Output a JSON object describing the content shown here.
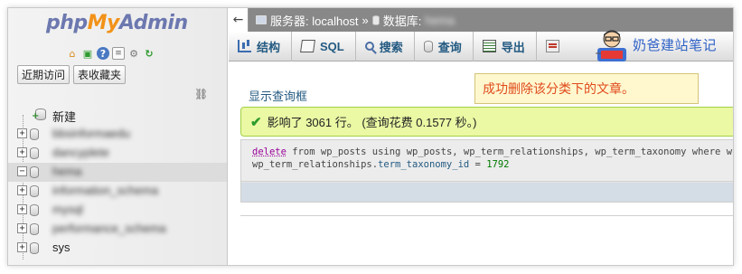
{
  "nav": {
    "logo": {
      "php": "php",
      "my": "My",
      "admin": "Admin"
    },
    "icons": [
      "home-icon",
      "exit-icon",
      "help-icon",
      "docs-icon",
      "settings-icon",
      "reload-icon"
    ],
    "tabs": [
      "近期访问",
      "表收藏夹"
    ],
    "tree": [
      {
        "label": "新建",
        "type": "new"
      },
      {
        "label": "bbsinformaedu",
        "type": "db",
        "blurred": true
      },
      {
        "label": "dancyplete",
        "type": "db",
        "blurred": true
      },
      {
        "label": "hema",
        "type": "db",
        "blurred": true,
        "selected": true
      },
      {
        "label": "information_schema",
        "type": "db",
        "blurred": true
      },
      {
        "label": "mysql",
        "type": "db",
        "blurred": true
      },
      {
        "label": "performance_schema",
        "type": "db",
        "blurred": true
      },
      {
        "label": "sys",
        "type": "db",
        "blurred": false
      }
    ]
  },
  "topbar": {
    "collapse": "←",
    "server_label": "服务器: localhost",
    "separator": "»",
    "db_label": "数据库:",
    "db_name": "hema"
  },
  "menu": [
    {
      "label": "结构",
      "icon": "structure-icon"
    },
    {
      "label": "SQL",
      "icon": "sql-icon"
    },
    {
      "label": "搜索",
      "icon": "search-icon"
    },
    {
      "label": "查询",
      "icon": "query-icon"
    },
    {
      "label": "导出",
      "icon": "export-icon"
    },
    {
      "label": "",
      "icon": "designer-icon"
    }
  ],
  "watermark": {
    "text": "奶爸建站笔记"
  },
  "main": {
    "show_query": "显示查询框",
    "tip": "成功删除该分类下的文章。",
    "success": "影响了 3061 行。 (查询花费 0.1577 秒。)",
    "sql": {
      "kw_delete": "delete",
      "line1_a": " from wp_posts using wp_posts, wp_term_relationships, wp_term_taxonomy where wp_post",
      "line2_a": "wp_term_relationships.",
      "line2_col": "term_taxonomy_id",
      "line2_op": " = ",
      "line2_num": "1792"
    }
  },
  "colors": {
    "accent": "#235a81",
    "success_bg": "#ebf8a4",
    "tip_text": "#e04a1c",
    "watermark_text": "#2f62c7"
  }
}
